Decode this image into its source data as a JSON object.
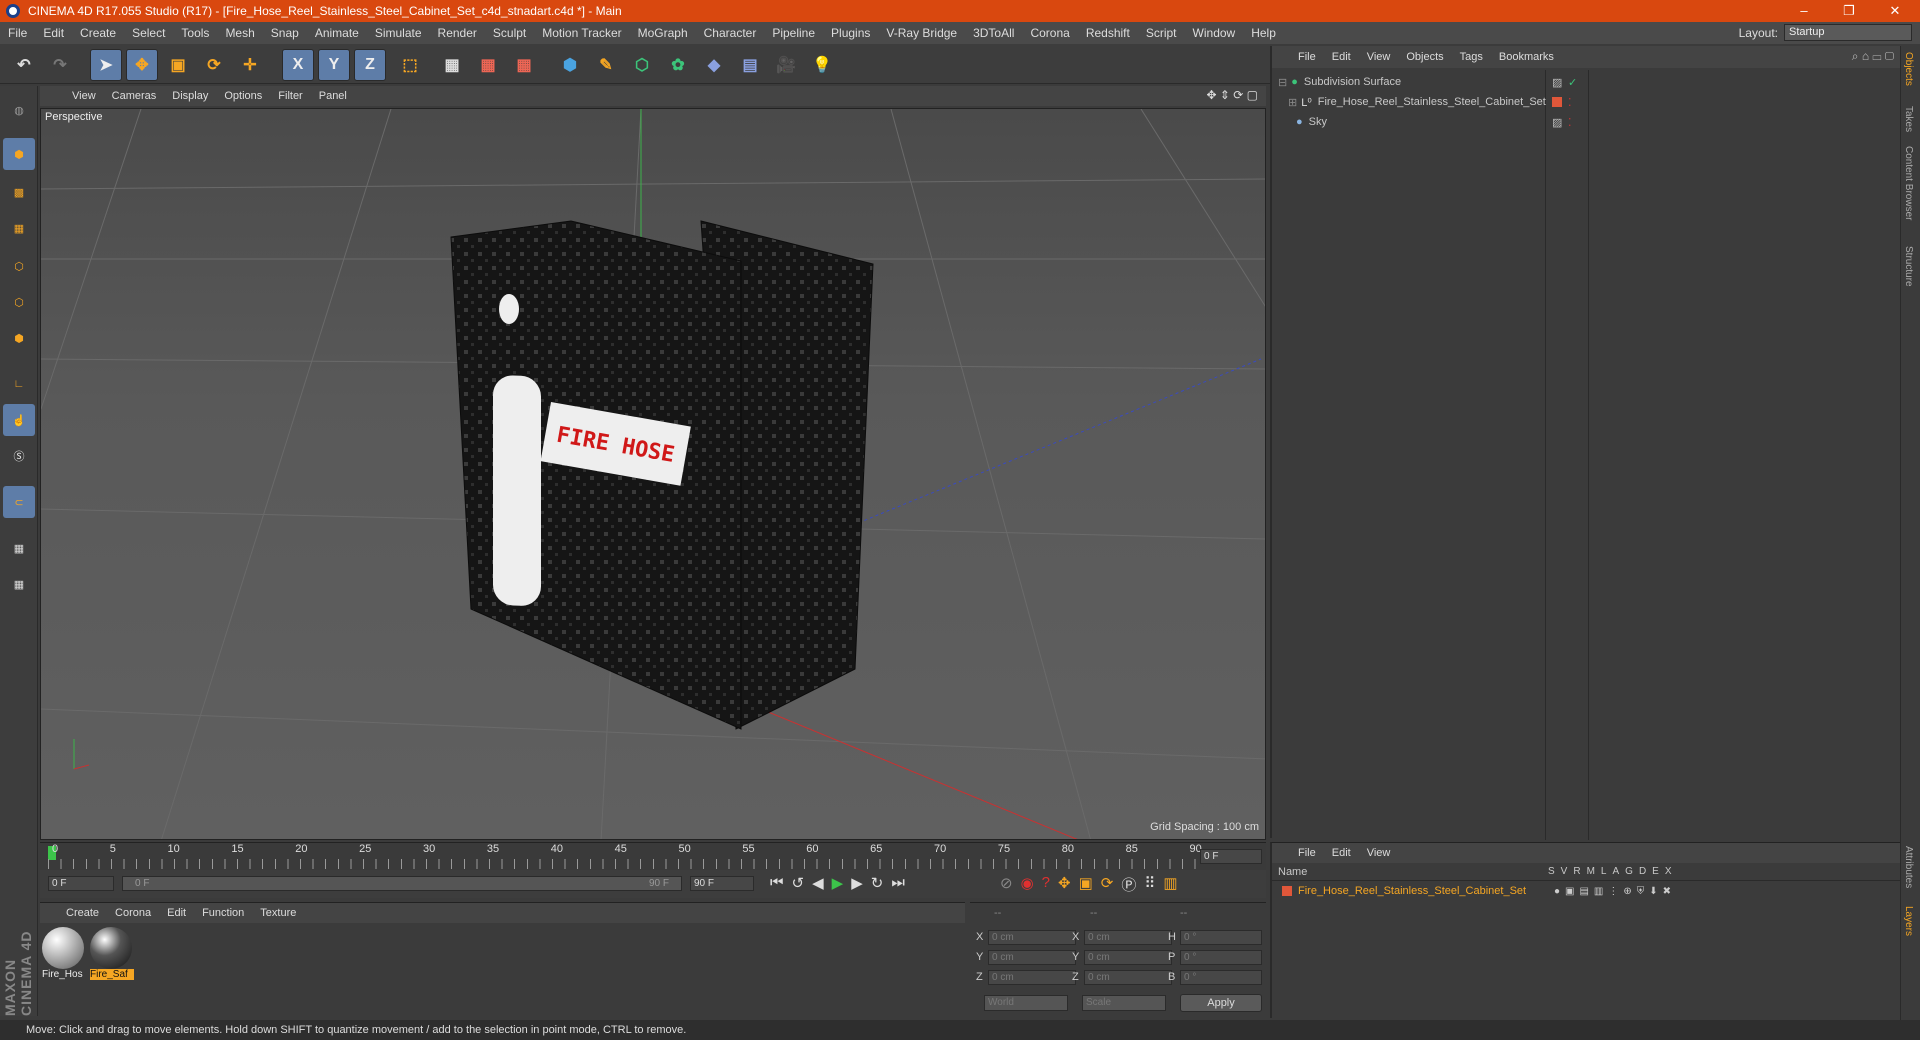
{
  "titlebar": {
    "title": "CINEMA 4D R17.055 Studio (R17) - [Fire_Hose_Reel_Stainless_Steel_Cabinet_Set_c4d_stnadart.c4d *] - Main",
    "minimize": "–",
    "restore": "❐",
    "close": "✕"
  },
  "menubar": {
    "items": [
      "File",
      "Edit",
      "Create",
      "Select",
      "Tools",
      "Mesh",
      "Snap",
      "Animate",
      "Simulate",
      "Render",
      "Sculpt",
      "Motion Tracker",
      "MoGraph",
      "Character",
      "Pipeline",
      "Plugins",
      "V-Ray Bridge",
      "3DToAll",
      "Corona",
      "Redshift",
      "Script",
      "Window",
      "Help"
    ],
    "layout_label": "Layout:",
    "layout_value": "Startup"
  },
  "toolbar": {
    "axis_x": "X",
    "axis_y": "Y",
    "axis_z": "Z"
  },
  "viewport": {
    "menu": [
      "View",
      "Cameras",
      "Display",
      "Options",
      "Filter",
      "Panel"
    ],
    "camera_label": "Perspective",
    "grid_spacing": "Grid Spacing : 100 cm",
    "label_text": "FIRE HOSE"
  },
  "timeline": {
    "ticks": [
      "0",
      "5",
      "10",
      "15",
      "20",
      "25",
      "30",
      "35",
      "40",
      "45",
      "50",
      "55",
      "60",
      "65",
      "70",
      "75",
      "80",
      "85",
      "90"
    ],
    "current_frame": "0 F",
    "start_field": "0 F",
    "range_start": "0 F",
    "range_end": "90 F",
    "end_field": "90 F"
  },
  "materials": {
    "menu": [
      "Create",
      "Corona",
      "Edit",
      "Function",
      "Texture"
    ],
    "items": [
      {
        "name": "Fire_Hos"
      },
      {
        "name": "Fire_Saf"
      }
    ]
  },
  "coords": {
    "header": [
      "--",
      "--",
      "--"
    ],
    "rows": [
      {
        "a": "X",
        "av": "0 cm",
        "b": "X",
        "bv": "0 cm",
        "c": "H",
        "cv": "0 °"
      },
      {
        "a": "Y",
        "av": "0 cm",
        "b": "Y",
        "bv": "0 cm",
        "c": "P",
        "cv": "0 °"
      },
      {
        "a": "Z",
        "av": "0 cm",
        "b": "Z",
        "bv": "0 cm",
        "c": "B",
        "cv": "0 °"
      }
    ],
    "world": "World",
    "scale": "Scale",
    "apply": "Apply"
  },
  "objects": {
    "menu": [
      "File",
      "Edit",
      "View",
      "Objects",
      "Tags",
      "Bookmarks"
    ],
    "rows": [
      {
        "name": "Subdivision Surface"
      },
      {
        "name": "Fire_Hose_Reel_Stainless_Steel_Cabinet_Set"
      },
      {
        "name": "Sky"
      }
    ]
  },
  "layers": {
    "menu": [
      "File",
      "Edit",
      "View"
    ],
    "name_header": "Name",
    "cols": [
      "S",
      "V",
      "R",
      "M",
      "L",
      "A",
      "G",
      "D",
      "E",
      "X"
    ],
    "row_name": "Fire_Hose_Reel_Stainless_Steel_Cabinet_Set"
  },
  "right_tabs": [
    "Objects",
    "Takes",
    "Content Browser",
    "Structure",
    "Attributes",
    "Layers"
  ],
  "maxon": "MAXON CINEMA 4D",
  "status": "Move: Click and drag to move elements. Hold down SHIFT to quantize movement / add to the selection in point mode, CTRL to remove.",
  "colors": {
    "titlebar": "#d9480f",
    "accent": "#5e7da8",
    "selected": "#f5a623"
  }
}
